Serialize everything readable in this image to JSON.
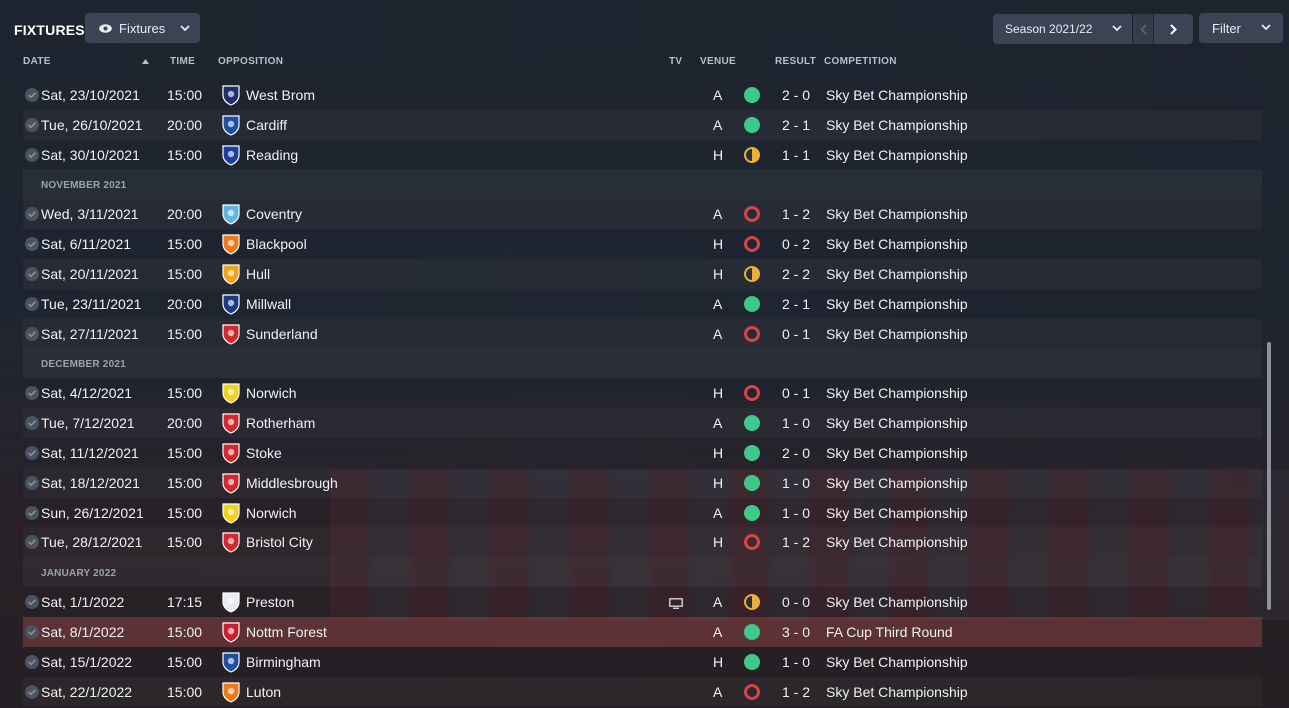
{
  "header": {
    "title": "FIXTURES",
    "view_label": "Fixtures",
    "season_label": "Season 2021/22",
    "filter_label": "Filter"
  },
  "columns": {
    "date": "DATE",
    "time": "TIME",
    "opposition": "OPPOSITION",
    "tv": "TV",
    "venue": "VENUE",
    "result": "RESULT",
    "competition": "COMPETITION"
  },
  "colors": {
    "win": "#3ec98a",
    "loss": "#d64545",
    "draw": "#e9b03c"
  },
  "rows": [
    {
      "type": "match",
      "date": "Sat, 23/10/2021",
      "time": "15:00",
      "opp": "West Brom",
      "venue": "A",
      "res": "win",
      "score": "2 - 0",
      "comp": "Sky Bet Championship",
      "badge": "#1f2f6b",
      "tv": false
    },
    {
      "type": "match",
      "date": "Tue, 26/10/2021",
      "time": "20:00",
      "opp": "Cardiff",
      "venue": "A",
      "res": "win",
      "score": "2 - 1",
      "comp": "Sky Bet Championship",
      "badge": "#1f4fa3",
      "tv": false
    },
    {
      "type": "match",
      "date": "Sat, 30/10/2021",
      "time": "15:00",
      "opp": "Reading",
      "venue": "H",
      "res": "draw",
      "score": "1 - 1",
      "comp": "Sky Bet Championship",
      "badge": "#1a3fa0",
      "tv": false
    },
    {
      "type": "month",
      "label": "NOVEMBER 2021"
    },
    {
      "type": "match",
      "date": "Wed, 3/11/2021",
      "time": "20:00",
      "opp": "Coventry",
      "venue": "A",
      "res": "loss",
      "score": "1 - 2",
      "comp": "Sky Bet Championship",
      "badge": "#5fb4e6",
      "tv": false
    },
    {
      "type": "match",
      "date": "Sat, 6/11/2021",
      "time": "15:00",
      "opp": "Blackpool",
      "venue": "H",
      "res": "loss",
      "score": "0 - 2",
      "comp": "Sky Bet Championship",
      "badge": "#f07a1a",
      "tv": false
    },
    {
      "type": "match",
      "date": "Sat, 20/11/2021",
      "time": "15:00",
      "opp": "Hull",
      "venue": "H",
      "res": "draw",
      "score": "2 - 2",
      "comp": "Sky Bet Championship",
      "badge": "#f2a31b",
      "tv": false
    },
    {
      "type": "match",
      "date": "Tue, 23/11/2021",
      "time": "20:00",
      "opp": "Millwall",
      "venue": "A",
      "res": "win",
      "score": "2 - 1",
      "comp": "Sky Bet Championship",
      "badge": "#1d3a84",
      "tv": false
    },
    {
      "type": "match",
      "date": "Sat, 27/11/2021",
      "time": "15:00",
      "opp": "Sunderland",
      "venue": "A",
      "res": "loss",
      "score": "0 - 1",
      "comp": "Sky Bet Championship",
      "badge": "#d8262f",
      "tv": false
    },
    {
      "type": "month",
      "label": "DECEMBER 2021"
    },
    {
      "type": "match",
      "date": "Sat, 4/12/2021",
      "time": "15:00",
      "opp": "Norwich",
      "venue": "H",
      "res": "loss",
      "score": "0 - 1",
      "comp": "Sky Bet Championship",
      "badge": "#f4d11b",
      "tv": false
    },
    {
      "type": "match",
      "date": "Tue, 7/12/2021",
      "time": "20:00",
      "opp": "Rotherham",
      "venue": "A",
      "res": "win",
      "score": "1 - 0",
      "comp": "Sky Bet Championship",
      "badge": "#d8262f",
      "tv": false
    },
    {
      "type": "match",
      "date": "Sat, 11/12/2021",
      "time": "15:00",
      "opp": "Stoke",
      "venue": "H",
      "res": "win",
      "score": "2 - 0",
      "comp": "Sky Bet Championship",
      "badge": "#d8262f",
      "tv": false
    },
    {
      "type": "match",
      "date": "Sat, 18/12/2021",
      "time": "15:00",
      "opp": "Middlesbrough",
      "venue": "H",
      "res": "win",
      "score": "1 - 0",
      "comp": "Sky Bet Championship",
      "badge": "#d8262f",
      "tv": false
    },
    {
      "type": "match",
      "date": "Sun, 26/12/2021",
      "time": "15:00",
      "opp": "Norwich",
      "venue": "A",
      "res": "win",
      "score": "1 - 0",
      "comp": "Sky Bet Championship",
      "badge": "#f4d11b",
      "tv": false
    },
    {
      "type": "match",
      "date": "Tue, 28/12/2021",
      "time": "15:00",
      "opp": "Bristol City",
      "venue": "H",
      "res": "loss",
      "score": "1 - 2",
      "comp": "Sky Bet Championship",
      "badge": "#d8262f",
      "tv": false
    },
    {
      "type": "month",
      "label": "JANUARY 2022"
    },
    {
      "type": "match",
      "date": "Sat, 1/1/2022",
      "time": "17:15",
      "opp": "Preston",
      "venue": "A",
      "res": "draw",
      "score": "0 - 0",
      "comp": "Sky Bet Championship",
      "badge": "#e8ecf1",
      "tv": true
    },
    {
      "type": "match",
      "date": "Sat, 8/1/2022",
      "time": "15:00",
      "opp": "Nottm Forest",
      "venue": "A",
      "res": "win",
      "score": "3 - 0",
      "comp": "FA Cup Third Round",
      "badge": "#c8202e",
      "tv": false,
      "highlight": true
    },
    {
      "type": "match",
      "date": "Sat, 15/1/2022",
      "time": "15:00",
      "opp": "Birmingham",
      "venue": "H",
      "res": "win",
      "score": "1 - 0",
      "comp": "Sky Bet Championship",
      "badge": "#1f4fa3",
      "tv": false
    },
    {
      "type": "match",
      "date": "Sat, 22/1/2022",
      "time": "15:00",
      "opp": "Luton",
      "venue": "A",
      "res": "loss",
      "score": "1 - 2",
      "comp": "Sky Bet Championship",
      "badge": "#f07a1a",
      "tv": false
    }
  ]
}
